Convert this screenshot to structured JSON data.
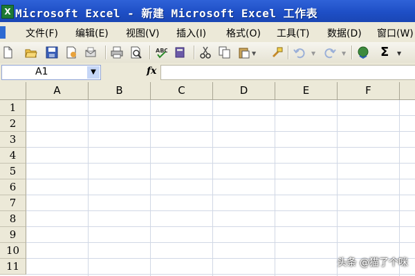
{
  "window": {
    "title": "Microsoft Excel - 新建 Microsoft Excel 工作表",
    "app_icon_letter": "X"
  },
  "menubar": {
    "items": [
      "文件(F)",
      "编辑(E)",
      "视图(V)",
      "插入(I)",
      "格式(O)",
      "工具(T)",
      "数据(D)",
      "窗口(W)"
    ]
  },
  "toolbar": {
    "buttons": [
      "new-icon",
      "open-icon",
      "save-icon",
      "permission-icon",
      "email-icon",
      "print-icon",
      "print-preview-icon",
      "spelling-icon",
      "research-icon",
      "cut-icon",
      "copy-icon",
      "paste-icon",
      "format-painter-icon",
      "undo-icon",
      "redo-icon",
      "hyperlink-icon",
      "autosum-icon"
    ],
    "autosum_symbol": "Σ"
  },
  "formula_bar": {
    "name_box": "A1",
    "fx_label": "fx",
    "formula": ""
  },
  "sheet": {
    "columns": [
      "A",
      "B",
      "C",
      "D",
      "E",
      "F"
    ],
    "rows": [
      "1",
      "2",
      "3",
      "4",
      "5",
      "6",
      "7",
      "8",
      "9",
      "10",
      "11"
    ]
  },
  "watermark": "头条 @猫了个咪",
  "colors": {
    "title_bar": "#1e4fc6",
    "chrome": "#ece9d8",
    "grid_lines": "#d0d7e5"
  }
}
